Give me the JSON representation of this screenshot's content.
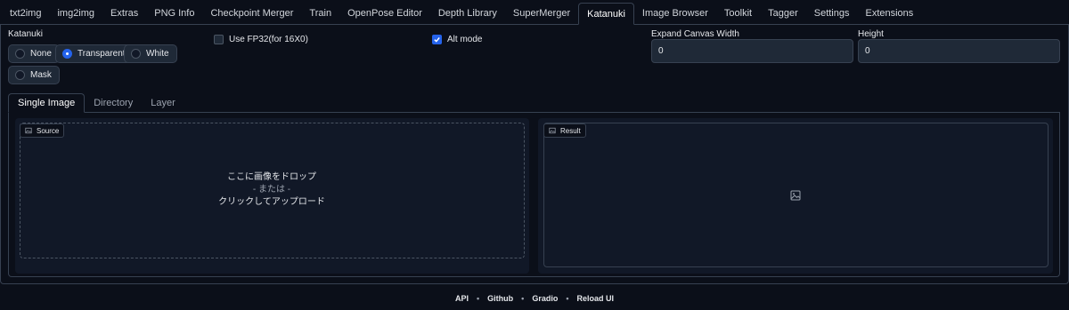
{
  "top_tabs": [
    {
      "label": "txt2img",
      "active": false
    },
    {
      "label": "img2img",
      "active": false
    },
    {
      "label": "Extras",
      "active": false
    },
    {
      "label": "PNG Info",
      "active": false
    },
    {
      "label": "Checkpoint Merger",
      "active": false
    },
    {
      "label": "Train",
      "active": false
    },
    {
      "label": "OpenPose Editor",
      "active": false
    },
    {
      "label": "Depth Library",
      "active": false
    },
    {
      "label": "SuperMerger",
      "active": false
    },
    {
      "label": "Katanuki",
      "active": true
    },
    {
      "label": "Image Browser",
      "active": false
    },
    {
      "label": "Toolkit",
      "active": false
    },
    {
      "label": "Tagger",
      "active": false
    },
    {
      "label": "Settings",
      "active": false
    },
    {
      "label": "Extensions",
      "active": false
    }
  ],
  "katanuki": {
    "label": "Katanuki",
    "options": [
      {
        "label": "None",
        "selected": false
      },
      {
        "label": "Transparent",
        "selected": true
      },
      {
        "label": "White",
        "selected": false
      },
      {
        "label": "Mask",
        "selected": false
      }
    ]
  },
  "use_fp32": {
    "label": "Use FP32(for 16X0)",
    "checked": false
  },
  "alt_mode": {
    "label": "Alt mode",
    "checked": true
  },
  "expand_width": {
    "label": "Expand Canvas Width",
    "value": "0"
  },
  "height": {
    "label": "Height",
    "value": "0"
  },
  "inner_tabs": [
    {
      "label": "Single Image",
      "active": true
    },
    {
      "label": "Directory",
      "active": false
    },
    {
      "label": "Layer",
      "active": false
    }
  ],
  "source": {
    "label": "Source",
    "drop_text": "ここに画像をドロップ",
    "or_text": "- または -",
    "click_text": "クリックしてアップロード"
  },
  "result": {
    "label": "Result"
  },
  "footer": {
    "links": [
      "API",
      "Github",
      "Gradio",
      "Reload UI"
    ],
    "separator": "•"
  },
  "colors": {
    "accent": "#2563eb",
    "background": "#0b0f19",
    "panel": "#111827",
    "border": "#374151"
  }
}
